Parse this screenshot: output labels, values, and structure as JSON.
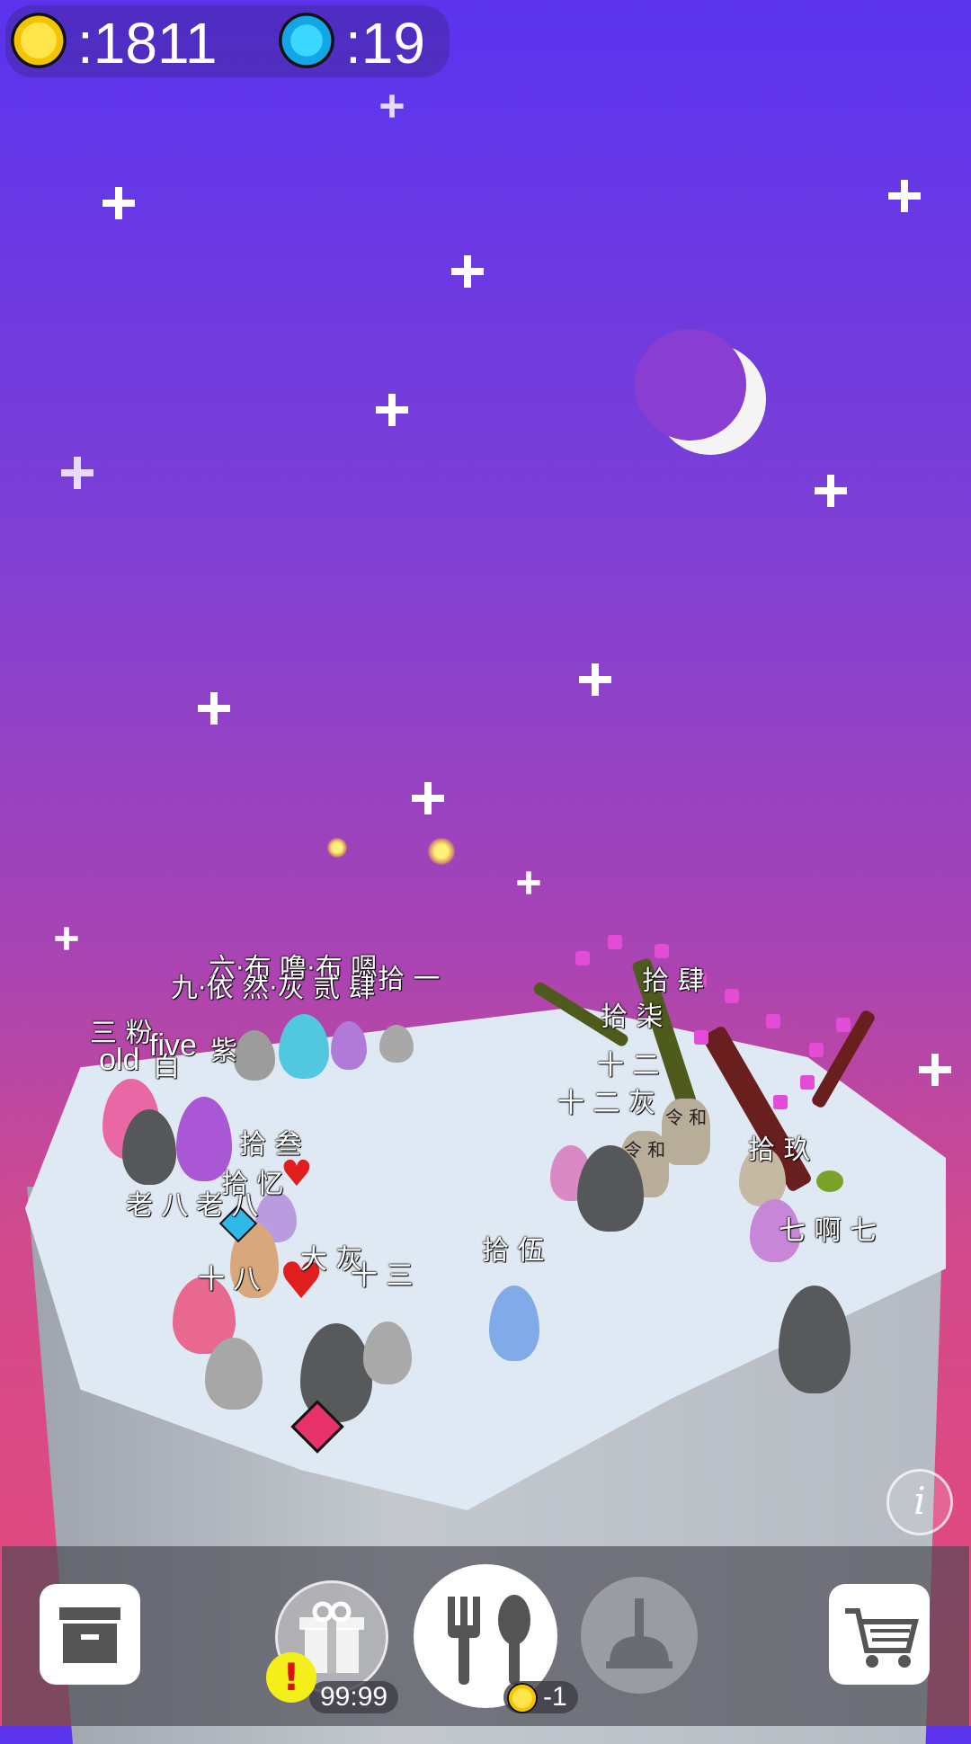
{
  "currency": {
    "coins_label": ":1811",
    "gems_label": ":19",
    "coin_icon": "gold-coin-icon",
    "gem_icon": "blue-gem-icon"
  },
  "creature_names": {
    "top_row_a": "六·布 噜·布 嗯",
    "top_row_b": "九·依 然·灰 贰 肆",
    "top_row_c": "拾 一",
    "three_pink": "三 粉",
    "five": "five",
    "purple_char": "紫",
    "old": "old",
    "old_suffix": "白",
    "shi_shen": "拾 叁",
    "shi_yi": "拾 忆",
    "lao_ba": "老 八",
    "lao_ba_2": "老 八",
    "shi_ba": "十 八",
    "da_hui": "大 灰",
    "shi_san": "十 三",
    "shi_wu": "拾 伍",
    "shi_si": "拾 肆",
    "shi_qi": "拾 柒",
    "shi_er": "十 二",
    "shi_er_hui": "十 二 灰",
    "shi_jiu": "拾 玖",
    "qi_a_qi": "七 啊 七"
  },
  "jar_text": "令 和",
  "info_label": "i",
  "toolbar": {
    "storage_icon": "storage-box-icon",
    "gift_icon": "gift-icon",
    "gift_timer": "99:99",
    "alert_label": "!",
    "feed_icon": "fork-spoon-icon",
    "feed_cost": "-1",
    "clean_icon": "plunger-icon",
    "shop_icon": "shopping-cart-icon"
  },
  "colors": {
    "sky_top": "#5a33ef",
    "sky_bottom": "#e84a7a",
    "coin": "#f5c400",
    "gem": "#14a4e8",
    "blossom": "#e24cd6"
  }
}
